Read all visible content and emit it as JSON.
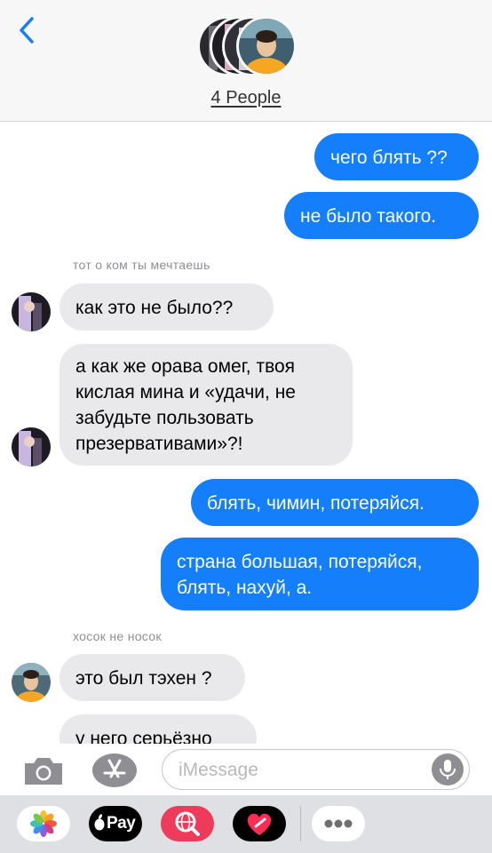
{
  "header": {
    "group_title": "4 People",
    "icons": {
      "back": "chevron-left-icon"
    }
  },
  "messages": [
    {
      "direction": "outgoing",
      "text": "чего блять ??"
    },
    {
      "direction": "outgoing",
      "text": "не было такого."
    },
    {
      "direction": "incoming",
      "sender": "тот о ком ты мечтаешь",
      "text": "как это не было??"
    },
    {
      "direction": "incoming",
      "text": "а как же орава омег, твоя кислая мина и «удачи, не забудьте пользовать презервативами»?!"
    },
    {
      "direction": "outgoing",
      "text": "блять, чимин, потеряйся."
    },
    {
      "direction": "outgoing",
      "text": "страна большая, потеряйся, блять, нахуй, а."
    },
    {
      "direction": "incoming",
      "sender": "хосок не носок",
      "text": "это был тэхен ?"
    },
    {
      "direction": "incoming",
      "text": "у него серьёзно"
    }
  ],
  "input_bar": {
    "placeholder": "iMessage",
    "value": "",
    "icons": {
      "camera": "camera-icon",
      "app_store": "app-store-icon",
      "mic": "microphone-icon"
    }
  },
  "app_drawer": {
    "apple_pay_label": "Pay",
    "icons": [
      "photos-icon",
      "apple-pay-icon",
      "image-search-icon",
      "digital-touch-icon",
      "more-icon"
    ]
  },
  "colors": {
    "outgoing_bubble": "#147efb",
    "incoming_bubble": "#e9e9eb",
    "header_bg": "#f7f7f7",
    "drawer_bg": "#dfe0e4",
    "accent": "#147efb"
  }
}
